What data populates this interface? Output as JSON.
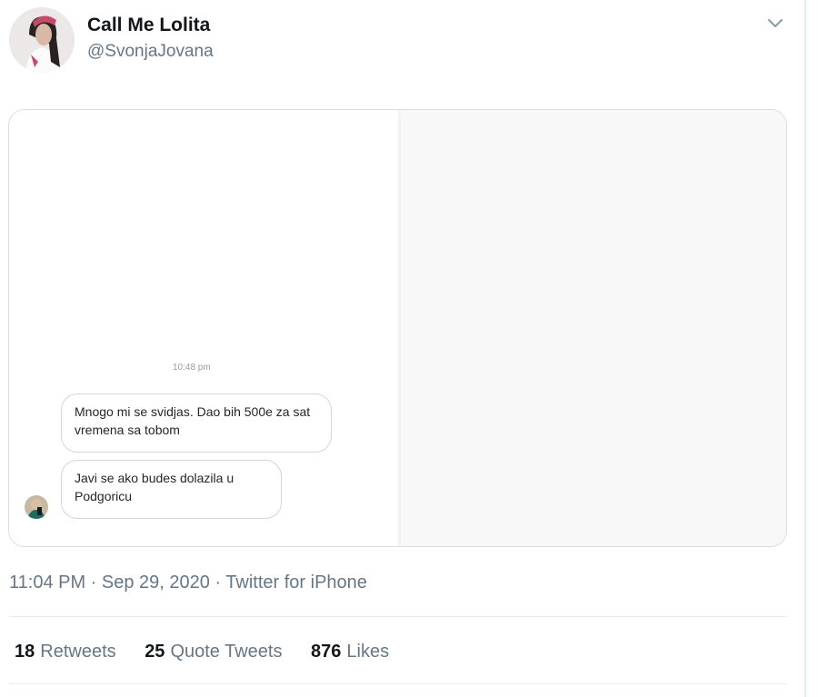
{
  "tweet": {
    "display_name": "Call Me Lolita",
    "handle": "@SvonjaJovana",
    "timestamp": "11:04 PM · Sep 29, 2020 · Twitter for iPhone",
    "stats": [
      {
        "count": "18",
        "label": "Retweets"
      },
      {
        "count": "25",
        "label": "Quote Tweets"
      },
      {
        "count": "876",
        "label": "Likes"
      }
    ],
    "caret_icon": "chevron-down-icon"
  },
  "media": {
    "chat": {
      "time": "10:48 pm",
      "messages": [
        {
          "text": "Mnogo mi se svidjas. Dao bih 500e za sat vremena sa tobom"
        },
        {
          "text": "Javi se ako budes dolazila u Podgoricu"
        }
      ]
    },
    "photo_icon": "blurred-profile-photo"
  },
  "colors": {
    "text_primary": "#14171a",
    "text_secondary": "#657786",
    "border": "#e6ecf0"
  }
}
